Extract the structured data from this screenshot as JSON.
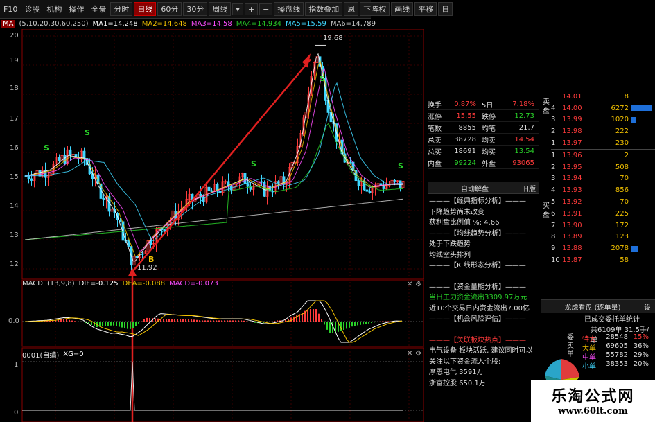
{
  "toolbar": {
    "items": [
      "F10",
      "诊股",
      "机构",
      "操作",
      "全景"
    ],
    "periods": [
      "分时",
      "日线",
      "60分",
      "30分",
      "周线"
    ],
    "active_period": "日线",
    "right_items": [
      "操盘线",
      "指数叠加",
      "恩",
      "下阵权",
      "画线",
      "平移",
      "日"
    ]
  },
  "ma_legend": {
    "prefix": "MA",
    "params": "(5,10,20,30,60,250)",
    "items": [
      {
        "label": "MA1=14.248",
        "color": "#ffffff"
      },
      {
        "label": "MA2=14.648",
        "color": "#f0c000"
      },
      {
        "label": "MA3=14.58",
        "color": "#ff4dff"
      },
      {
        "label": "MA4=14.934",
        "color": "#29d129"
      },
      {
        "label": "MA5=15.59",
        "color": "#3fd7ff"
      },
      {
        "label": "MA6=14.789",
        "color": "#cccccc"
      }
    ]
  },
  "price_axis": [
    "20",
    "19",
    "18",
    "17",
    "16",
    "15",
    "14",
    "13",
    "12"
  ],
  "price_annotations": {
    "high": "19.68",
    "low": "11.92"
  },
  "signals": {
    "s": "S",
    "b": "B"
  },
  "macd_legend": {
    "name": "MACD",
    "params": "(13,9,8)",
    "dif": "DIF=-0.125",
    "dea": "DEA=-0.088",
    "macd": "MACD=-0.073"
  },
  "macd_axis": "0.0",
  "sub_legend": {
    "name": "0001(自编)",
    "xg": "XG=0"
  },
  "sub_axis": [
    "0",
    "1"
  ],
  "stats": [
    {
      "l1": "换手",
      "v1": "0.87%",
      "c1": "red",
      "l2": "5日",
      "v2": "7.18%",
      "c2": "red"
    },
    {
      "l1": "涨停",
      "v1": "15.55",
      "c1": "red",
      "l2": "跌停",
      "v2": "12.73",
      "c2": "green"
    },
    {
      "l1": "笔数",
      "v1": "8855",
      "c1": "white",
      "l2": "均笔",
      "v2": "21.7",
      "c2": "white"
    },
    {
      "l1": "总卖",
      "v1": "38728",
      "c1": "white",
      "l2": "均卖",
      "v2": "14.54",
      "c2": "red"
    },
    {
      "l1": "总买",
      "v1": "18691",
      "c1": "white",
      "l2": "均买",
      "v2": "13.54",
      "c2": "green"
    },
    {
      "l1": "内盘",
      "v1": "99224",
      "c1": "green",
      "l2": "外盘",
      "v2": "93065",
      "c2": "red"
    }
  ],
  "auto_review": {
    "title": "自动解盘",
    "old": "旧版"
  },
  "analysis": [
    {
      "text": "———【经典指标分析】———",
      "color": "white"
    },
    {
      "text": "下降趋势尚未改变",
      "color": "white"
    },
    {
      "text": "获利盘比例值 %: 4.66",
      "color": "white"
    },
    {
      "text": "———【均线趋势分析】———",
      "color": "white"
    },
    {
      "text": "处于下跌趋势",
      "color": "white"
    },
    {
      "text": "均线空头排列",
      "color": "white"
    },
    {
      "text": "———【K 线形态分析】———",
      "color": "white"
    },
    {
      "text": "",
      "color": "white"
    },
    {
      "text": "———【资金量能分析】———",
      "color": "white"
    },
    {
      "text": "当日主力资金流出3309.97万元",
      "color": "green"
    },
    {
      "text": "近10个交易日内资金流出7.00亿",
      "color": "white"
    },
    {
      "text": "———【机会风险评估】———",
      "color": "white"
    },
    {
      "text": "",
      "color": "white"
    },
    {
      "text": "———【关联板块热点】———",
      "color": "red"
    },
    {
      "text": "电气设备 板块活跃, 建议同时可以",
      "color": "white"
    },
    {
      "text": "关注以下资金流入个股:",
      "color": "white"
    },
    {
      "text": "摩恩电气 3591万",
      "color": "white"
    },
    {
      "text": "浙富控股 650.1万",
      "color": "white"
    }
  ],
  "sell_side_label": "卖盘",
  "sell_rows": [
    {
      "n": "",
      "p": "14.01",
      "v": "8"
    },
    {
      "n": "4",
      "p": "14.00",
      "v": "6272"
    },
    {
      "n": "3",
      "p": "13.99",
      "v": "1020"
    },
    {
      "n": "2",
      "p": "13.98",
      "v": "222"
    },
    {
      "n": "1",
      "p": "13.97",
      "v": "230"
    }
  ],
  "buy_side_label": "买盘",
  "buy_rows": [
    {
      "n": "1",
      "p": "13.96",
      "v": "2"
    },
    {
      "n": "2",
      "p": "13.95",
      "v": "508"
    },
    {
      "n": "3",
      "p": "13.94",
      "v": "70"
    },
    {
      "n": "4",
      "p": "13.93",
      "v": "856"
    },
    {
      "n": "5",
      "p": "13.92",
      "v": "70"
    },
    {
      "n": "6",
      "p": "13.91",
      "v": "225"
    },
    {
      "n": "7",
      "p": "13.90",
      "v": "172"
    },
    {
      "n": "8",
      "p": "13.89",
      "v": "123"
    },
    {
      "n": "9",
      "p": "13.88",
      "v": "2078"
    },
    {
      "n": "10",
      "p": "13.87",
      "v": "58"
    }
  ],
  "dragon": {
    "title": "龙虎看盘 (逐单量)",
    "settings": "设",
    "subtitle": "已成交委托单统计",
    "total": "共6109单 31.5手/单",
    "side_label": "委卖单",
    "rows": [
      {
        "l": "特大",
        "v": "28548",
        "p": "15%"
      },
      {
        "l": "大单",
        "v": "69605",
        "p": "36%"
      },
      {
        "l": "中单",
        "v": "55782",
        "p": "29%"
      },
      {
        "l": "小单",
        "v": "38353",
        "p": "20%"
      }
    ]
  },
  "watermark": {
    "title": "乐淘公式网",
    "url": "www.60lt.com"
  },
  "colors": {
    "up": "#ff3b3b",
    "down": "#3fd7ff",
    "arrow": "#e02020",
    "bg": "#000000"
  }
}
